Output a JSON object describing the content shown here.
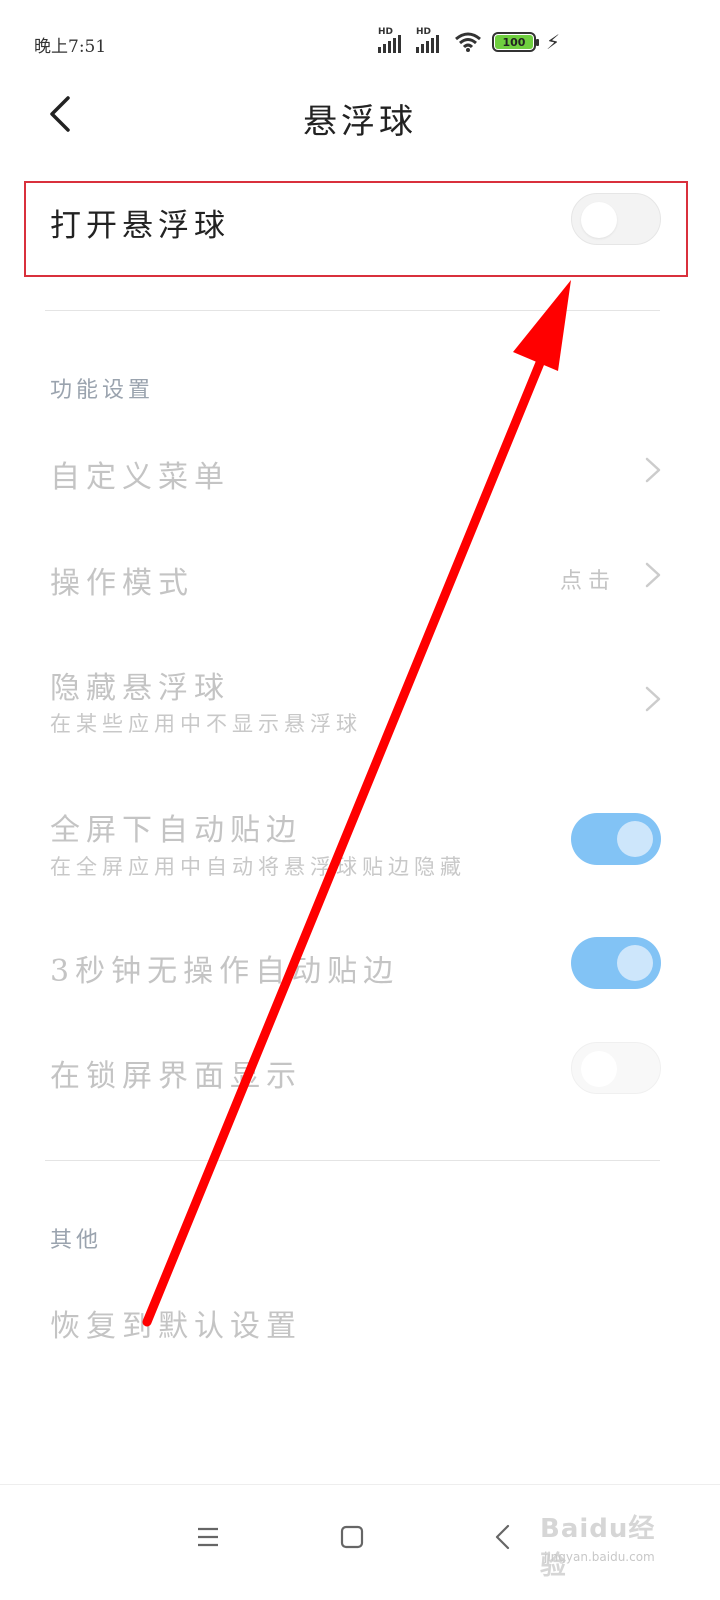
{
  "status_bar": {
    "time": "晚上7:51",
    "signal_1_label": "HD",
    "signal_2_label": "HD",
    "battery_level": "100",
    "icons": [
      "signal-hd-icon",
      "signal-hd-icon",
      "wifi-icon",
      "battery-icon",
      "charging-bolt-icon"
    ]
  },
  "header": {
    "title": "悬浮球",
    "back_icon": "back-chevron-icon"
  },
  "main_toggle": {
    "label": "打开悬浮球",
    "state": "off"
  },
  "function_section": {
    "header": "功能设置",
    "custom_menu": {
      "title": "自定义菜单"
    },
    "operation_mode": {
      "title": "操作模式",
      "value": "点击"
    },
    "hide_ball": {
      "title": "隐藏悬浮球",
      "subtitle": "在某些应用中不显示悬浮球"
    },
    "fullscreen_edge": {
      "title": "全屏下自动贴边",
      "subtitle": "在全屏应用中自动将悬浮球贴边隐藏",
      "state": "on"
    },
    "idle_edge": {
      "title": "3秒钟无操作自动贴边",
      "state": "on"
    },
    "lockscreen_show": {
      "title": "在锁屏界面显示",
      "state": "off"
    }
  },
  "other_section": {
    "header": "其他",
    "restore_defaults": "恢复到默认设置"
  },
  "annotation": {
    "highlight_color": "#d9303c",
    "arrow_color": "#ff0000"
  },
  "nav_bar": {
    "menu_icon": "menu-icon",
    "home_icon": "home-square-icon",
    "back_icon": "back-triangle-icon"
  },
  "watermark": {
    "text": "Baidu经验",
    "url": "jingyan.baidu.com"
  }
}
